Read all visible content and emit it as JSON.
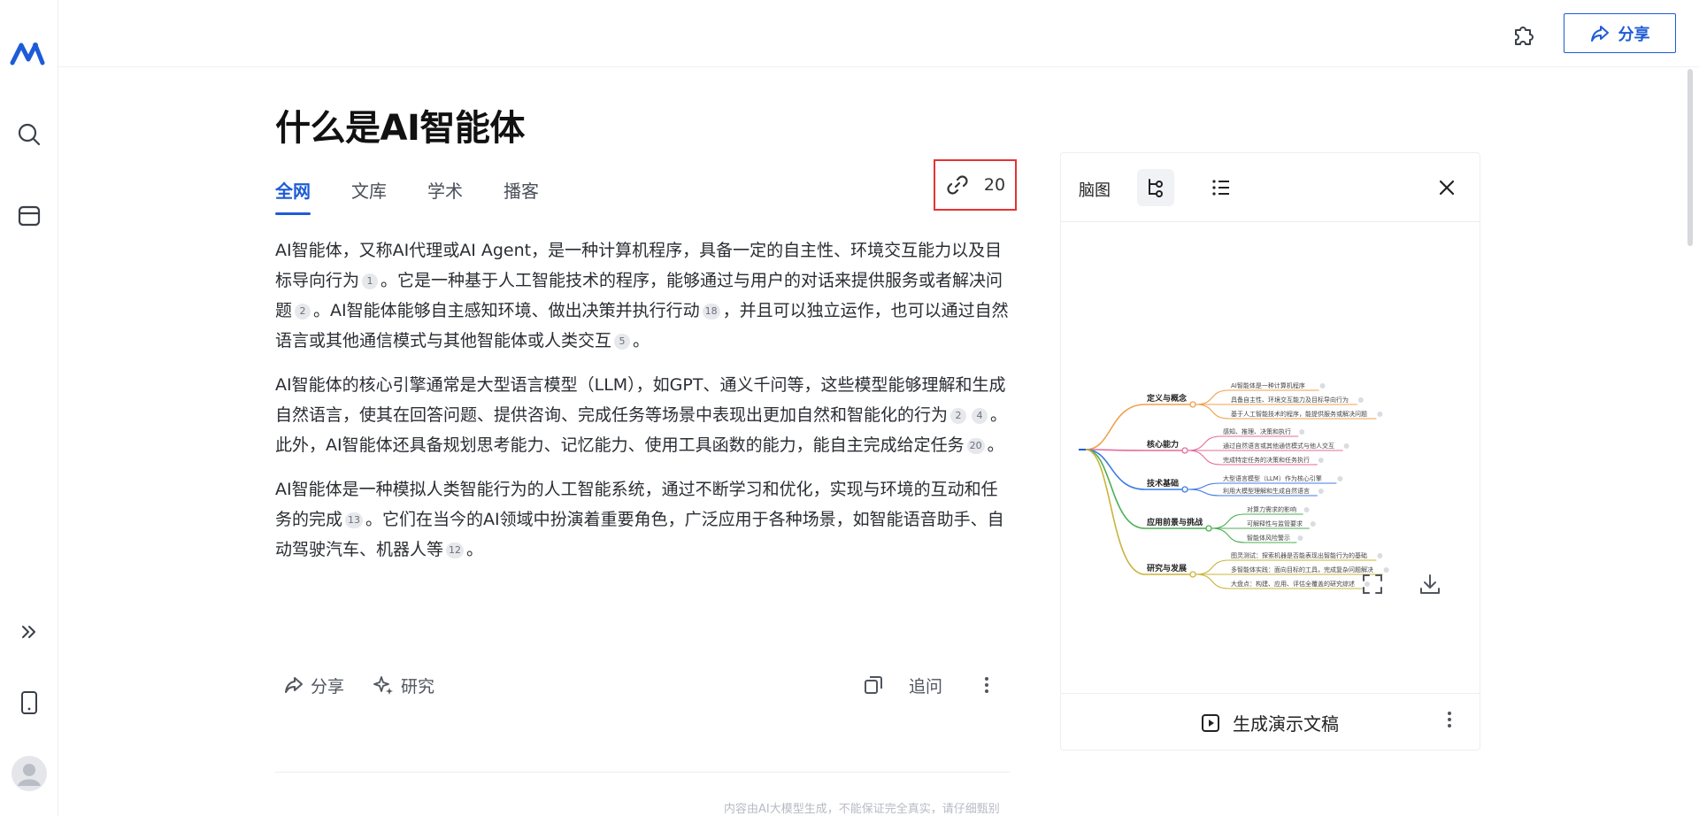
{
  "header": {
    "share_label": "分享"
  },
  "article": {
    "title": "什么是AI智能体",
    "tabs": [
      {
        "label": "全网",
        "active": true
      },
      {
        "label": "文库",
        "active": false
      },
      {
        "label": "学术",
        "active": false
      },
      {
        "label": "播客",
        "active": false
      }
    ],
    "ref_count": "20",
    "paragraphs": [
      [
        {
          "t": "AI智能体，又称AI代理或AI Agent，是一种计算机程序，具备一定的自主性、环境交互能力以及目标导向行为"
        },
        {
          "c": "1"
        },
        {
          "t": "。它是一种基于人工智能技术的程序，能够通过与用户的对话来提供服务或者解决问题"
        },
        {
          "c": "2"
        },
        {
          "t": "。AI智能体能够自主感知环境、做出决策并执行行动"
        },
        {
          "c": "18"
        },
        {
          "t": "，并且可以独立运作，也可以通过自然语言或其他通信模式与其他智能体或人类交互"
        },
        {
          "c": "5"
        },
        {
          "t": "。"
        }
      ],
      [
        {
          "t": "AI智能体的核心引擎通常是大型语言模型（LLM），如GPT、通义千问等，这些模型能够理解和生成自然语言，使其在回答问题、提供咨询、完成任务等场景中表现出更加自然和智能化的行为"
        },
        {
          "c": "2"
        },
        {
          "c": "4"
        },
        {
          "t": "。此外，AI智能体还具备规划思考能力、记忆能力、使用工具函数的能力，能自主完成给定任务"
        },
        {
          "c": "20"
        },
        {
          "t": "。"
        }
      ],
      [
        {
          "t": "AI智能体是一种模拟人类智能行为的人工智能系统，通过不断学习和优化，实现与环境的互动和任务的完成"
        },
        {
          "c": "13"
        },
        {
          "t": "。它们在当今的AI领域中扮演着重要角色，广泛应用于各种场景，如智能语音助手、自动驾驶汽车、机器人等"
        },
        {
          "c": "12"
        },
        {
          "t": "。"
        }
      ]
    ],
    "actions": {
      "share": "分享",
      "research": "研究",
      "followup": "追问"
    },
    "disclaimer": "内容由AI大模型生成，不能保证完全真实，请仔细甄别"
  },
  "mindmap_panel": {
    "label": "脑图",
    "generate_label": "生成演示文稿",
    "branches": [
      {
        "name": "定义与概念",
        "color": "#f0a04b",
        "leaves": [
          "AI智能体是一种计算机程序",
          "具备自主性、环境交互能力及目标导向行为",
          "基于人工智能技术的程序，能提供服务或解决问题"
        ]
      },
      {
        "name": "核心能力",
        "color": "#e36c9a",
        "leaves": [
          "感知、推理、决策和执行",
          "通过自然语言或其他通信模式与他人交互",
          "完成特定任务的决策和任务执行"
        ]
      },
      {
        "name": "技术基础",
        "color": "#3d7be6",
        "leaves": [
          "大型语言模型（LLM）作为核心引擎",
          "利用大模型理解和生成自然语言"
        ]
      },
      {
        "name": "应用前景与挑战",
        "color": "#4caf50",
        "leaves": [
          "对算力需求的影响",
          "可解释性与监管要求",
          "智能体风险警示"
        ]
      },
      {
        "name": "研究与发展",
        "color": "#c9b43a",
        "leaves": [
          "图灵测试：探索机器是否能表现出智能行为的基础",
          "多智能体实践：面向目标的工具，完成复杂问题解决",
          "大盘点：构建、应用、评估全覆盖的研究综述"
        ]
      }
    ]
  },
  "colors": {
    "accent": "#1e5bd6",
    "highlight_border": "#e53333"
  }
}
